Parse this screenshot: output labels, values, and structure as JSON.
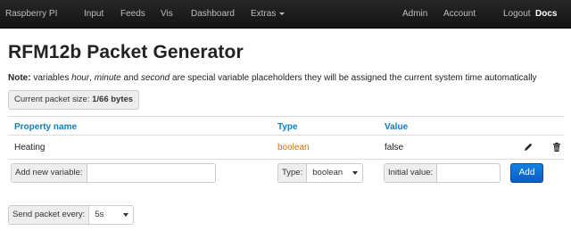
{
  "navbar": {
    "left_items": [
      "Raspberry PI",
      "Input",
      "Feeds",
      "Vis",
      "Dashboard",
      "Extras"
    ],
    "right_items": [
      "Admin",
      "Account",
      "Logout",
      "Docs"
    ]
  },
  "page": {
    "title": "RFM12b Packet Generator",
    "note_label": "Note:",
    "note_text_1": " variables ",
    "note_hour": "hour",
    "note_text_2": ", ",
    "note_minute": "minute",
    "note_text_3": " and ",
    "note_second": "second",
    "note_text_4": " are special variable placeholders they will be assigned the current system time automatically",
    "packet_size_label": "Current packet size: ",
    "packet_size_value": "1/66 bytes"
  },
  "table": {
    "headers": [
      "Property name",
      "Type",
      "Value"
    ],
    "rows": [
      {
        "name": "Heating",
        "type": "boolean",
        "value": "false"
      }
    ]
  },
  "add_row": {
    "name_label": "Add new variable:",
    "name_value": "",
    "type_label": "Type:",
    "type_selected": "boolean",
    "initial_label": "Initial value:",
    "initial_value": "",
    "add_button": "Add"
  },
  "send": {
    "label": "Send packet every:",
    "selected": "5s"
  },
  "icons": {
    "edit": "pencil-icon",
    "delete": "trash-icon"
  },
  "colors": {
    "accent": "#0e7fbe",
    "type_text": "#c87114",
    "button": "#0b6fd1",
    "navbar": "#1b1b1b"
  }
}
